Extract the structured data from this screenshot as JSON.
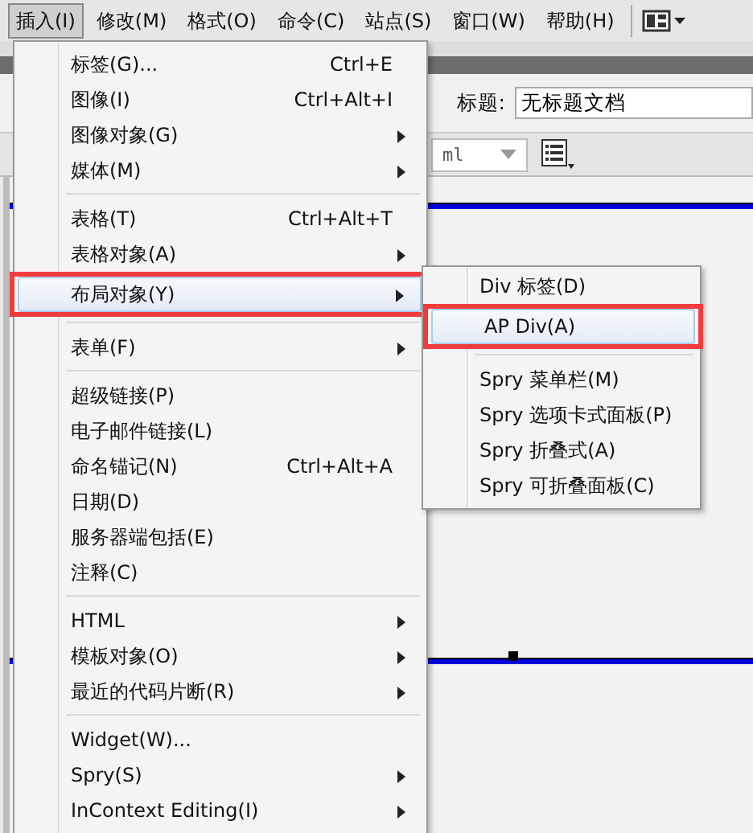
{
  "menubar": [
    {
      "label": "插入(I)",
      "selected": true
    },
    {
      "label": "修改(M)",
      "selected": false
    },
    {
      "label": "格式(O)",
      "selected": false
    },
    {
      "label": "命令(C)",
      "selected": false
    },
    {
      "label": "站点(S)",
      "selected": false
    },
    {
      "label": "窗口(W)",
      "selected": false
    },
    {
      "label": "帮助(H)",
      "selected": false
    }
  ],
  "title_field": {
    "label": "标题:",
    "value": "无标题文档"
  },
  "doctype_dropdown": {
    "value": "ml"
  },
  "insert_menu": {
    "items": [
      {
        "kind": "item",
        "label": "标签(G)...",
        "shortcut": "Ctrl+E",
        "hovered": false,
        "annotated": false
      },
      {
        "kind": "item",
        "label": "图像(I)",
        "shortcut": "Ctrl+Alt+I",
        "hovered": false,
        "annotated": false
      },
      {
        "kind": "submenu",
        "label": "图像对象(G)",
        "hovered": false,
        "annotated": false
      },
      {
        "kind": "submenu",
        "label": "媒体(M)",
        "hovered": false,
        "annotated": false
      },
      {
        "kind": "separator"
      },
      {
        "kind": "item",
        "label": "表格(T)",
        "shortcut": "Ctrl+Alt+T",
        "hovered": false,
        "annotated": false
      },
      {
        "kind": "submenu",
        "label": "表格对象(A)",
        "hovered": false,
        "annotated": false
      },
      {
        "kind": "submenu",
        "label": "布局对象(Y)",
        "hovered": true,
        "annotated": true
      },
      {
        "kind": "separator"
      },
      {
        "kind": "submenu",
        "label": "表单(F)",
        "hovered": false,
        "annotated": false
      },
      {
        "kind": "separator"
      },
      {
        "kind": "item",
        "label": "超级链接(P)",
        "hovered": false,
        "annotated": false
      },
      {
        "kind": "item",
        "label": "电子邮件链接(L)",
        "hovered": false,
        "annotated": false
      },
      {
        "kind": "item",
        "label": "命名锚记(N)",
        "shortcut": "Ctrl+Alt+A",
        "hovered": false,
        "annotated": false
      },
      {
        "kind": "item",
        "label": "日期(D)",
        "hovered": false,
        "annotated": false
      },
      {
        "kind": "item",
        "label": "服务器端包括(E)",
        "hovered": false,
        "annotated": false
      },
      {
        "kind": "item",
        "label": "注释(C)",
        "hovered": false,
        "annotated": false
      },
      {
        "kind": "separator"
      },
      {
        "kind": "submenu",
        "label": "HTML",
        "hovered": false,
        "annotated": false
      },
      {
        "kind": "submenu",
        "label": "模板对象(O)",
        "hovered": false,
        "annotated": false
      },
      {
        "kind": "submenu",
        "label": "最近的代码片断(R)",
        "hovered": false,
        "annotated": false
      },
      {
        "kind": "separator"
      },
      {
        "kind": "item",
        "label": "Widget(W)...",
        "hovered": false,
        "annotated": false
      },
      {
        "kind": "submenu",
        "label": "Spry(S)",
        "hovered": false,
        "annotated": false
      },
      {
        "kind": "submenu",
        "label": "InContext Editing(I)",
        "hovered": false,
        "annotated": false
      }
    ]
  },
  "layout_submenu": {
    "items": [
      {
        "kind": "item",
        "label": "Div 标签(D)",
        "hovered": false,
        "annotated": false
      },
      {
        "kind": "item",
        "label": "AP Div(A)",
        "hovered": true,
        "annotated": true
      },
      {
        "kind": "separator"
      },
      {
        "kind": "item",
        "label": "Spry 菜单栏(M)",
        "hovered": false,
        "annotated": false
      },
      {
        "kind": "item",
        "label": "Spry 选项卡式面板(P)",
        "hovered": false,
        "annotated": false
      },
      {
        "kind": "item",
        "label": "Spry 折叠式(A)",
        "hovered": false,
        "annotated": false
      },
      {
        "kind": "item",
        "label": "Spry 可折叠面板(C)",
        "hovered": false,
        "annotated": false
      }
    ]
  }
}
